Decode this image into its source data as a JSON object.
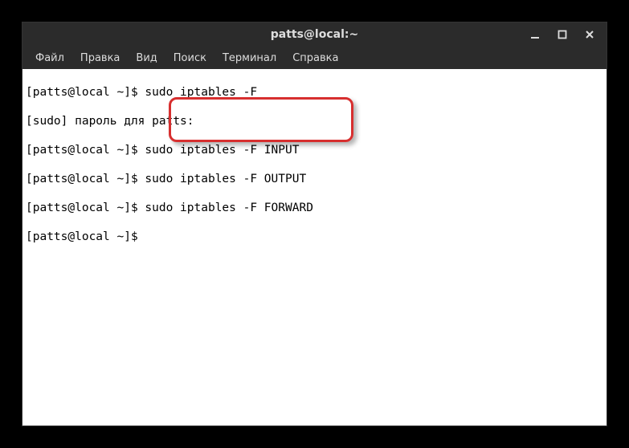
{
  "window": {
    "title": "patts@local:~"
  },
  "menubar": {
    "items": [
      {
        "label": "Файл"
      },
      {
        "label": "Правка"
      },
      {
        "label": "Вид"
      },
      {
        "label": "Поиск"
      },
      {
        "label": "Терминал"
      },
      {
        "label": "Справка"
      }
    ]
  },
  "terminal": {
    "lines": [
      "[patts@local ~]$ sudo iptables -F",
      "[sudo] пароль для patts:",
      "[patts@local ~]$ sudo iptables -F INPUT",
      "[patts@local ~]$ sudo iptables -F OUTPUT",
      "[patts@local ~]$ sudo iptables -F FORWARD",
      "[patts@local ~]$ "
    ]
  },
  "highlight": {
    "commands": [
      "sudo iptables -F INPUT",
      "sudo iptables -F OUTPUT",
      "sudo iptables -F FORWARD"
    ]
  }
}
